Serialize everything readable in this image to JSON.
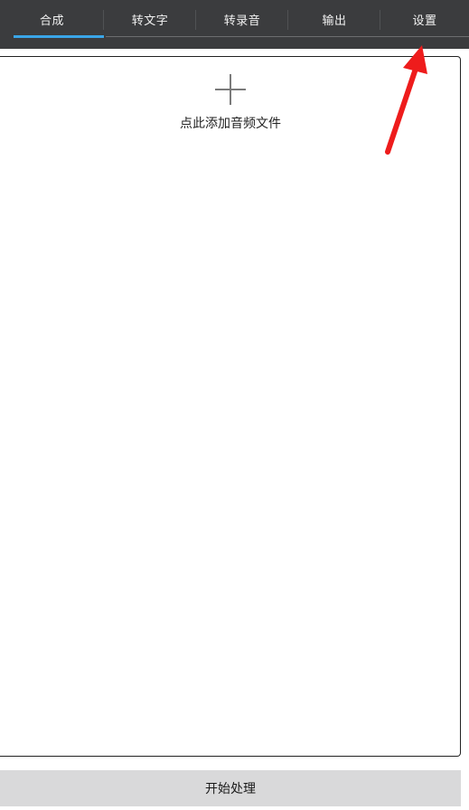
{
  "tabs": [
    {
      "label": "合成",
      "active": true
    },
    {
      "label": "转文字",
      "active": false
    },
    {
      "label": "转录音",
      "active": false
    },
    {
      "label": "输出",
      "active": false
    },
    {
      "label": "设置",
      "active": false
    }
  ],
  "main": {
    "add_label": "点此添加音频文件"
  },
  "footer": {
    "start_label": "开始处理"
  },
  "colors": {
    "topbar": "#3b3c3e",
    "active_tab_underline": "#3aa6e8",
    "annotation_arrow": "#ee1c1c",
    "start_button_bg": "#d9d9da"
  },
  "icons": {
    "add": "plus-icon",
    "annotation": "red-arrow-icon"
  }
}
